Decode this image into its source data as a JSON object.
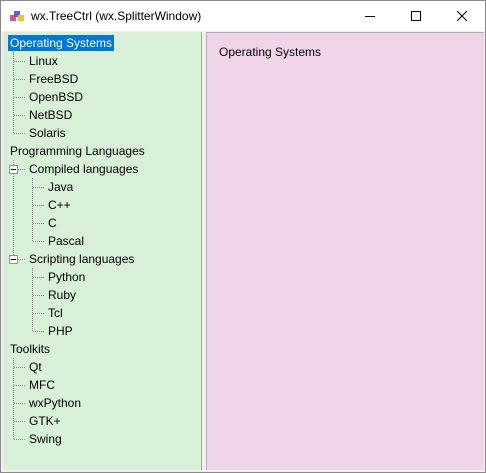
{
  "window": {
    "title": "wx.TreeCtrl (wx.SplitterWindow)"
  },
  "tree": {
    "nodes": [
      {
        "label": "Operating Systems",
        "selected": true
      },
      {
        "label": "Linux"
      },
      {
        "label": "FreeBSD"
      },
      {
        "label": "OpenBSD"
      },
      {
        "label": "NetBSD"
      },
      {
        "label": "Solaris"
      },
      {
        "label": "Programming Languages"
      },
      {
        "label": "Compiled languages",
        "expanded": true
      },
      {
        "label": "Java"
      },
      {
        "label": "C++"
      },
      {
        "label": "C"
      },
      {
        "label": "Pascal"
      },
      {
        "label": "Scripting languages",
        "expanded": true
      },
      {
        "label": "Python"
      },
      {
        "label": "Ruby"
      },
      {
        "label": "Tcl"
      },
      {
        "label": "PHP"
      },
      {
        "label": "Toolkits"
      },
      {
        "label": "Qt"
      },
      {
        "label": "MFC"
      },
      {
        "label": "wxPython"
      },
      {
        "label": "GTK+"
      },
      {
        "label": "Swing"
      }
    ]
  },
  "content": {
    "label": "Operating Systems"
  },
  "colors": {
    "tree_background": "#d8f0d8",
    "content_background": "#f0d4e8",
    "selection": "#0078d7"
  }
}
